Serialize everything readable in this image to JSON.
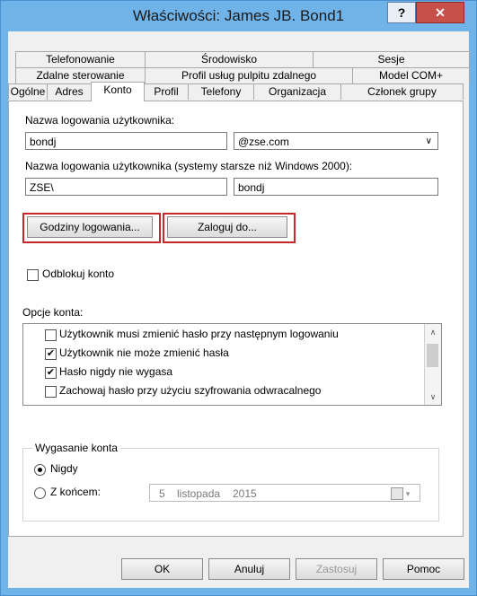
{
  "window": {
    "title": "Właściwości: James JB. Bond1",
    "help_label": "?",
    "close_label": "✕"
  },
  "tabs": {
    "row1": [
      "Telefonowanie",
      "Środowisko",
      "Sesje"
    ],
    "row2": [
      "Zdalne sterowanie",
      "Profil usług pulpitu zdalnego",
      "Model COM+"
    ],
    "row3": [
      "Ogólne",
      "Adres",
      "Konto",
      "Profil",
      "Telefony",
      "Organizacja",
      "Członek grupy"
    ],
    "active": "Konto"
  },
  "account": {
    "logon_name_label": "Nazwa logowania użytkownika:",
    "logon_name_value": "bondj",
    "domain_value": "@zse.com",
    "pre2000_label": "Nazwa logowania użytkownika (systemy starsze niż Windows 2000):",
    "pre2000_domain": "ZSE\\",
    "pre2000_user": "bondj",
    "logon_hours_button": "Godziny logowania...",
    "logon_to_button": "Zaloguj do...",
    "unlock_label": "Odblokuj konto",
    "options_label": "Opcje konta:",
    "options": [
      {
        "label": "Użytkownik musi zmienić hasło przy następnym logowaniu",
        "checked": false
      },
      {
        "label": "Użytkownik nie może zmienić hasła",
        "checked": true
      },
      {
        "label": "Hasło nigdy nie wygasa",
        "checked": true
      },
      {
        "label": "Zachowaj hasło przy użyciu szyfrowania odwracalnego",
        "checked": false
      }
    ],
    "expiry": {
      "group_title": "Wygasanie konta",
      "never_label": "Nigdy",
      "end_label": "Z końcem:",
      "selected": "never",
      "date_day": "5",
      "date_month": "listopada",
      "date_year": "2015"
    }
  },
  "footer": {
    "ok": "OK",
    "cancel": "Anuluj",
    "apply": "Zastosuj",
    "help": "Pomoc"
  },
  "colors": {
    "title_bar": "#6fb3e8",
    "close_button": "#c7504a",
    "highlight_box": "#c8262a"
  }
}
